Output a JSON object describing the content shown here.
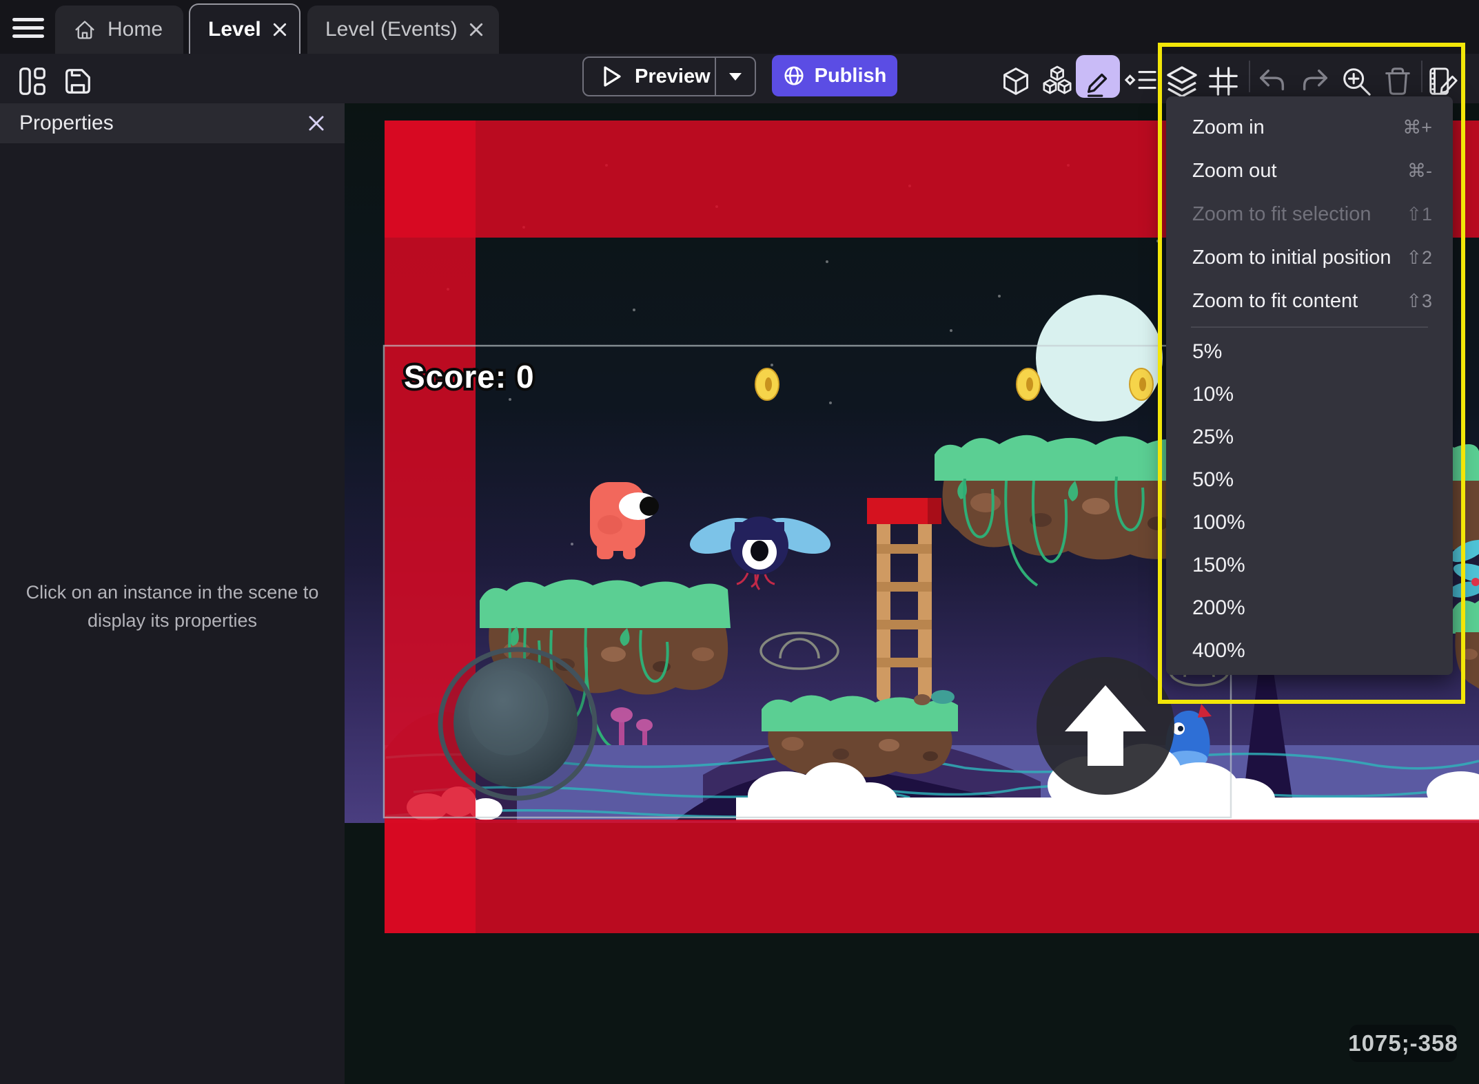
{
  "window": {
    "tabs": [
      {
        "label": "Home",
        "active": false
      },
      {
        "label": "Level",
        "active": true
      },
      {
        "label": "Level (Events)",
        "active": false
      }
    ]
  },
  "toolbar": {
    "preview_label": "Preview",
    "publish_label": "Publish",
    "icons": [
      "project-manager",
      "save",
      "objects",
      "object-groups",
      "edit-mode",
      "instances-list",
      "layers",
      "grid",
      "undo",
      "redo",
      "zoom-in",
      "delete",
      "scene-properties"
    ]
  },
  "properties_panel": {
    "title": "Properties",
    "empty_message": "Click on an instance in the scene to display its properties"
  },
  "zoom_menu": {
    "items": [
      {
        "label": "Zoom in",
        "shortcut": "⌘+",
        "disabled": false
      },
      {
        "label": "Zoom out",
        "shortcut": "⌘-",
        "disabled": false
      },
      {
        "label": "Zoom to fit selection",
        "shortcut": "⇧1",
        "disabled": true
      },
      {
        "label": "Zoom to initial position",
        "shortcut": "⇧2",
        "disabled": false
      },
      {
        "label": "Zoom to fit content",
        "shortcut": "⇧3",
        "disabled": false
      }
    ],
    "zoom_levels": [
      "5%",
      "10%",
      "25%",
      "50%",
      "100%",
      "150%",
      "200%",
      "400%"
    ]
  },
  "scene": {
    "score_label": "Score: 0",
    "cursor_coordinates": "1075;-358"
  },
  "colors": {
    "accent_purple": "#5b4de4",
    "highlight_yellow": "#f2e608",
    "overlay_red": "#dc0a22",
    "active_tool_lavender": "#c9bbf7",
    "menu_background": "#33333c",
    "panel_background": "#1b1b22"
  }
}
